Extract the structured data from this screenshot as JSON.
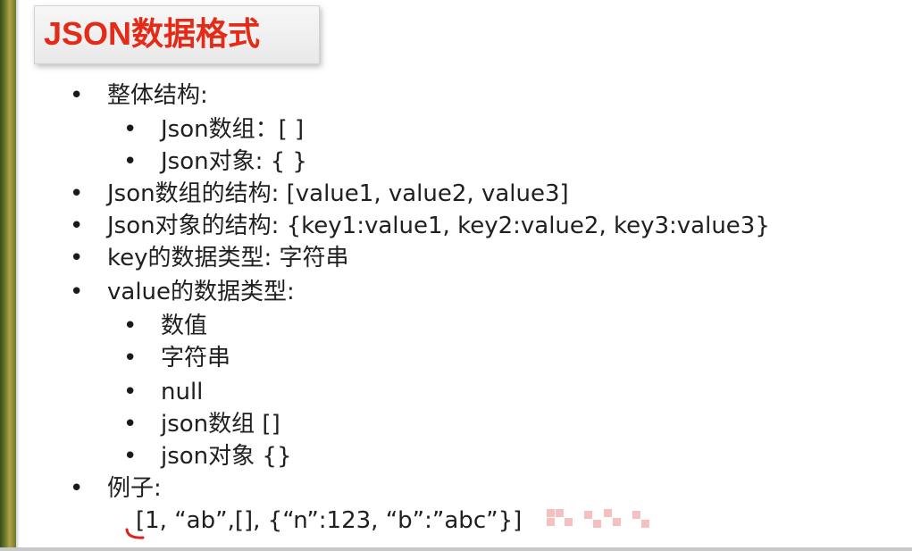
{
  "slide": {
    "title": "JSON数据格式",
    "items": [
      {
        "label": "整体结构:"
      },
      {
        "label": "Json数组：[ ]"
      },
      {
        "label": "Json对象: {  }"
      },
      {
        "label": "Json数组的结构: [value1, value2, value3]"
      },
      {
        "label": "Json对象的结构: {key1:value1, key2:value2, key3:value3}"
      },
      {
        "label": "key的数据类型: 字符串"
      },
      {
        "label": "value的数据类型:"
      },
      {
        "label": "数值"
      },
      {
        "label": "字符串"
      },
      {
        "label": "null"
      },
      {
        "label": "json数组 []"
      },
      {
        "label": "json对象 {}"
      },
      {
        "label": "例子:"
      }
    ],
    "example": "[1, “ab”,[], {“n”:123, “b”:”abc”}]"
  },
  "colors": {
    "title_red": "#e32b18",
    "text": "#202020",
    "annotation_red": "#e0201c"
  }
}
